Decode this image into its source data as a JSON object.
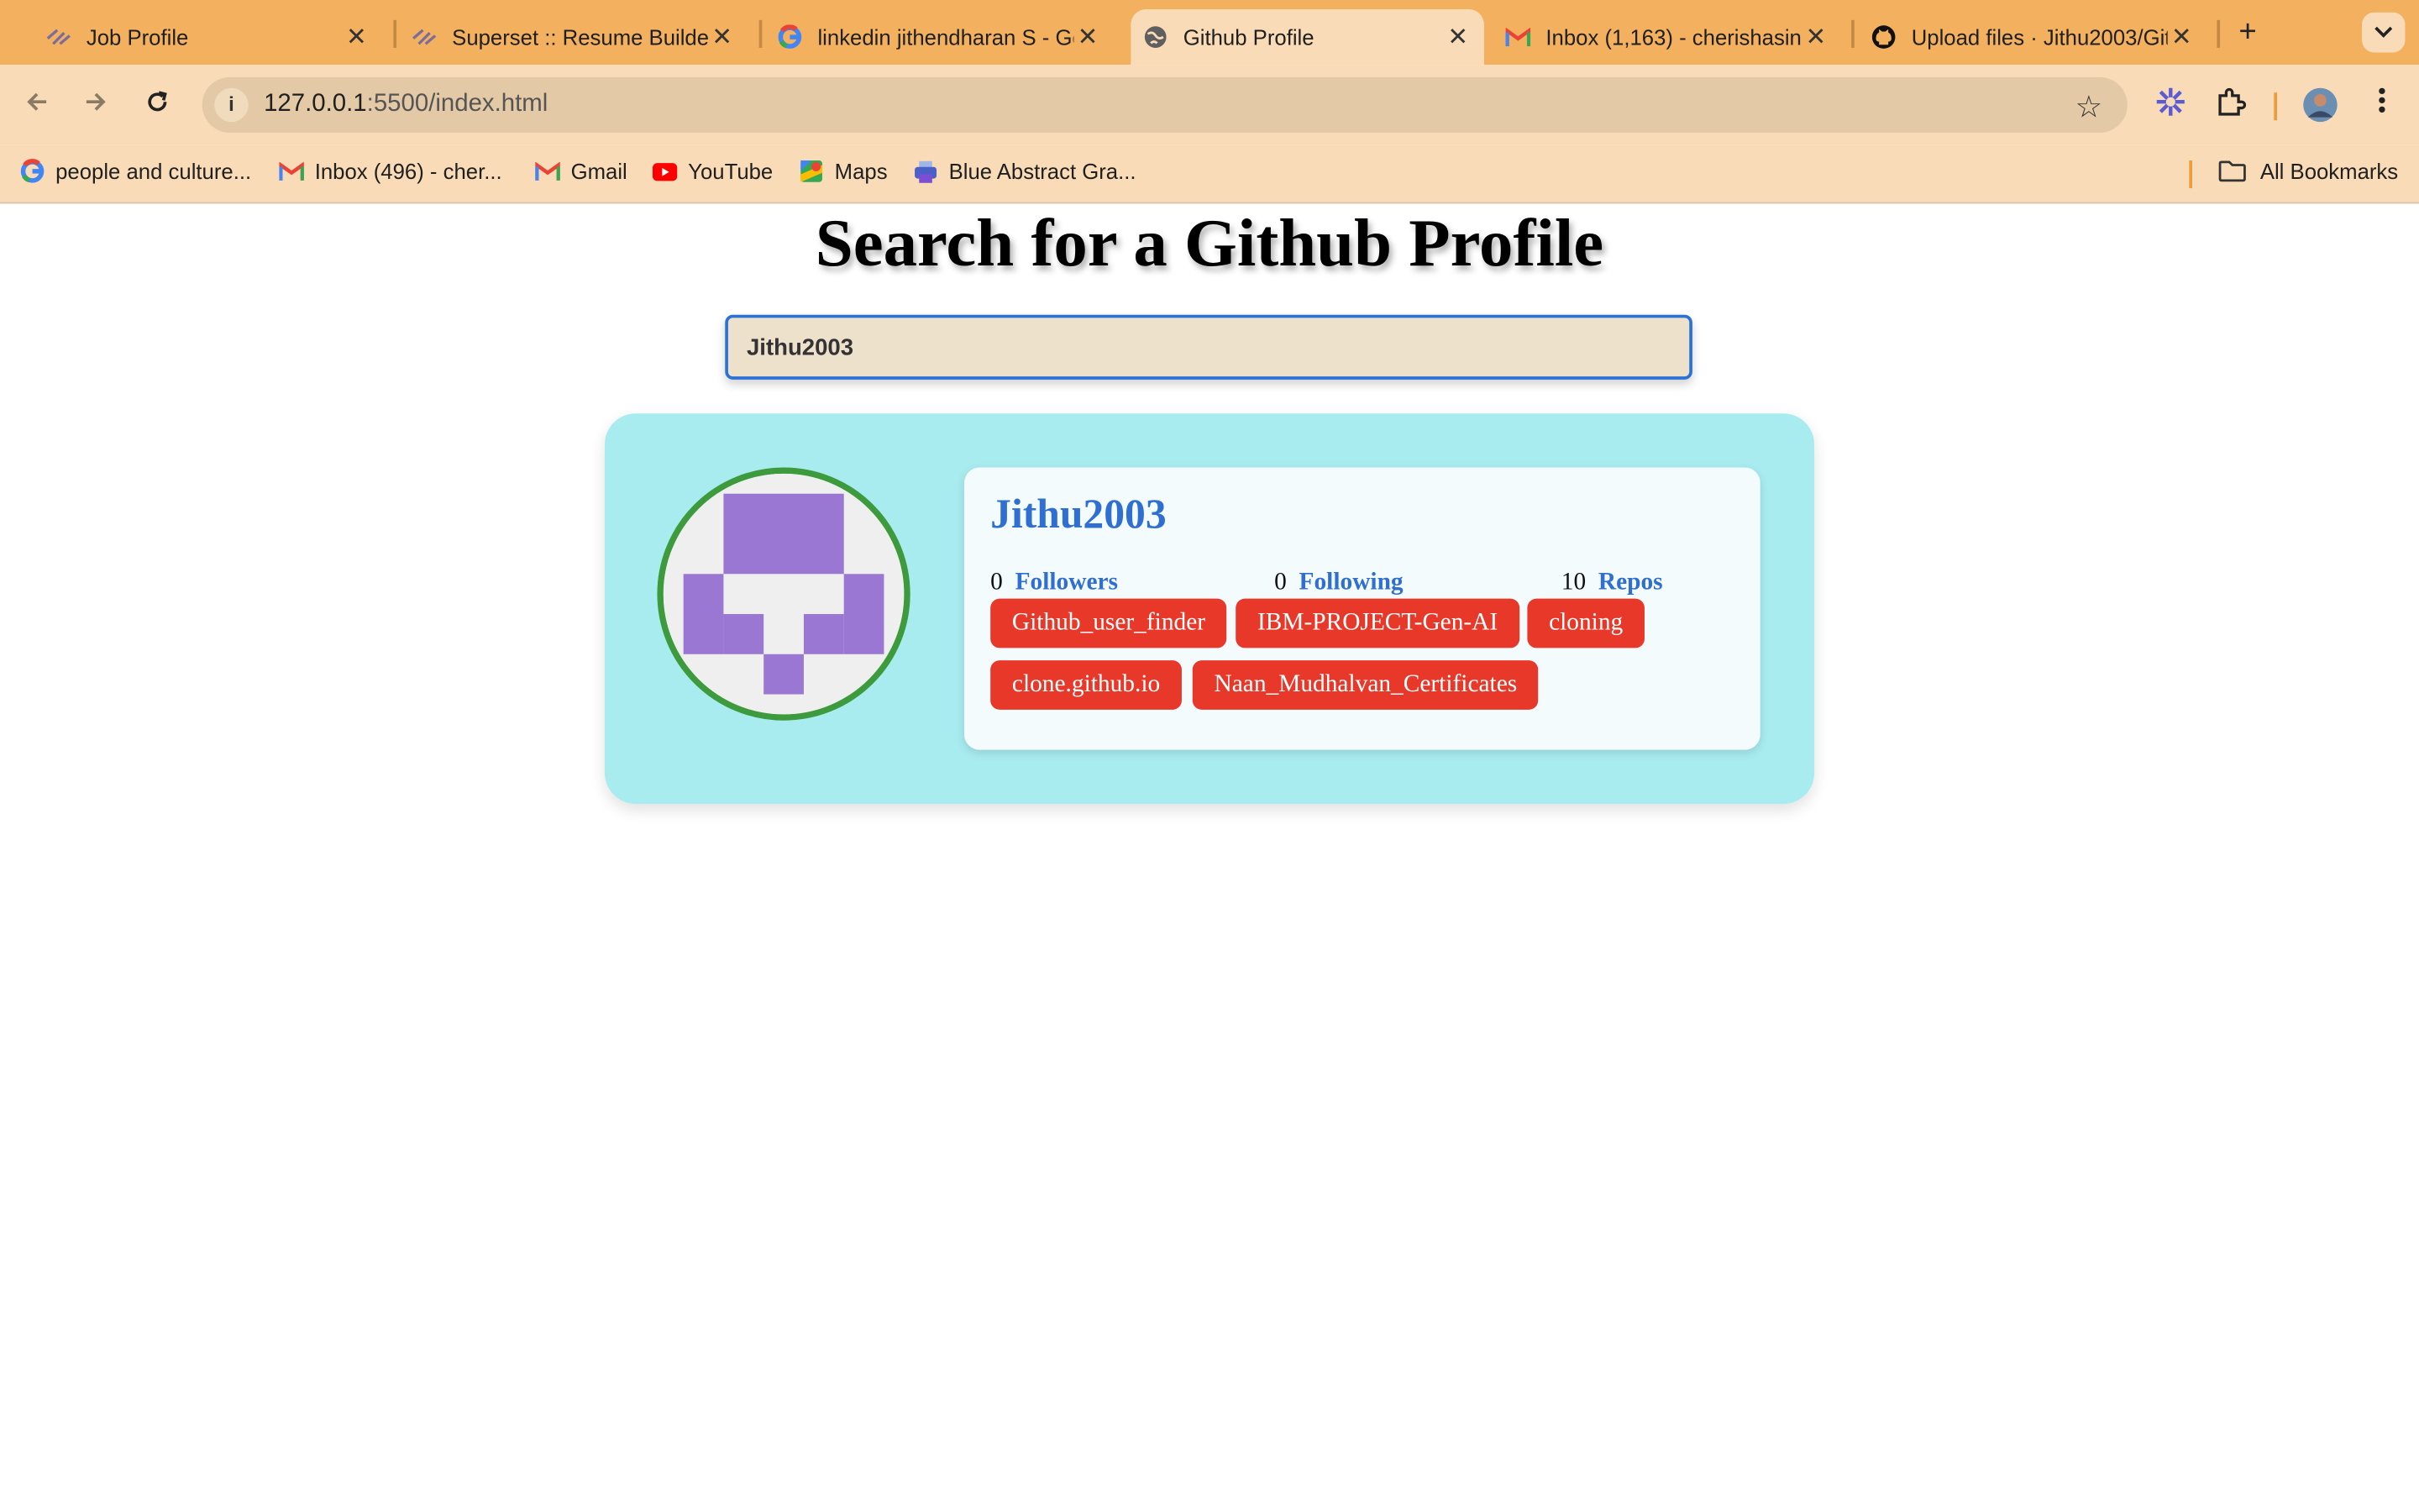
{
  "browser": {
    "tabs": [
      {
        "title": "Job Profile",
        "icon": "superset-icon",
        "active": false
      },
      {
        "title": "Superset :: Resume Builder",
        "icon": "superset-icon",
        "active": false
      },
      {
        "title": "linkedin jithendharan S - Google Search",
        "icon": "google-icon",
        "active": false
      },
      {
        "title": "Github Profile",
        "icon": "globe-icon",
        "active": true
      },
      {
        "title": "Inbox (1,163) - cherishasingh",
        "icon": "gmail-icon",
        "active": false
      },
      {
        "title": "Upload files · Jithu2003/Github",
        "icon": "github-icon",
        "active": false
      }
    ],
    "new_tab_glyph": "+",
    "address": {
      "host": "127.0.0.1",
      "path": ":5500/index.html"
    },
    "bookmarks": [
      {
        "label": "people and culture...",
        "icon": "google-icon"
      },
      {
        "label": "Inbox (496) - cher...",
        "icon": "gmail-icon"
      },
      {
        "label": "Gmail",
        "icon": "gmail-icon"
      },
      {
        "label": "YouTube",
        "icon": "youtube-icon"
      },
      {
        "label": "Maps",
        "icon": "maps-icon"
      },
      {
        "label": "Blue Abstract Gra...",
        "icon": "print-icon"
      }
    ],
    "all_bookmarks": "All Bookmarks"
  },
  "page": {
    "heading": "Search for a Github Profile",
    "search_value": "Jithu2003",
    "profile": {
      "username": "Jithu2003",
      "followers": "0",
      "followers_label": "Followers",
      "following": "0",
      "following_label": "Following",
      "repos": "10",
      "repos_label": "Repos",
      "repo_list": [
        "Github_user_finder",
        "IBM-PROJECT-Gen-AI",
        "cloning",
        "clone.github.io",
        "Naan_Mudhalvan_Certificates"
      ]
    }
  },
  "colors": {
    "tabstrip": "#f3b05f",
    "toolbar": "#f9dcb7",
    "card": "#a8ecf0",
    "repo_tag": "#e8382a",
    "link_blue": "#2f6fd1",
    "avatar_border": "#3d9a3d",
    "identicon": "#9b77d4"
  }
}
